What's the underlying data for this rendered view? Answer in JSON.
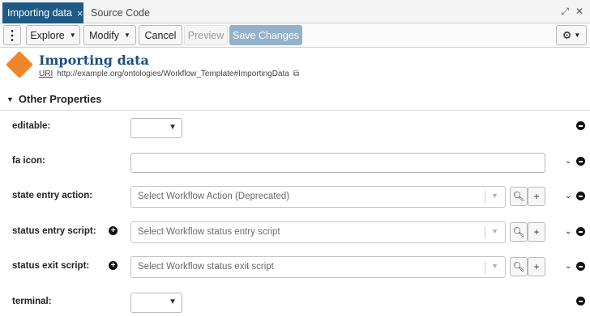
{
  "tabs": {
    "active": {
      "label": "Importing data",
      "close": "×"
    },
    "inactive": {
      "label": "Source Code"
    },
    "window_icons": [
      "⤢",
      "✕"
    ]
  },
  "toolbar": {
    "menu": "⋮",
    "explore": "Explore",
    "modify": "Modify",
    "cancel": "Cancel",
    "preview": "Preview",
    "save": "Save Changes",
    "settings": "⚙"
  },
  "resource": {
    "title": "Importing data",
    "uri_label": "URI",
    "uri": "http://example.org/ontologies/Workflow_Template#ImportingData",
    "icon": "diamond-icon"
  },
  "section": {
    "title": "Other Properties"
  },
  "properties": {
    "editable": {
      "label": "editable:"
    },
    "fa_icon": {
      "label": "fa icon:",
      "value": ""
    },
    "state_entry_action": {
      "label": "state entry action:",
      "placeholder": "Select Workflow Action (Deprecated)"
    },
    "status_entry_script": {
      "label": "status entry script:",
      "placeholder": "Select Workflow status entry script"
    },
    "status_exit_script": {
      "label": "status exit script:",
      "placeholder": "Select Workflow status exit script"
    },
    "terminal": {
      "label": "terminal:"
    }
  },
  "colors": {
    "tab_active_bg": "#1d5a86",
    "save_btn_bg": "#93b1cc",
    "resource_icon": "#f0862b",
    "title_color": "#1d4f7b"
  }
}
